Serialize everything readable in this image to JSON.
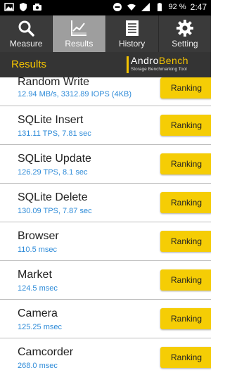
{
  "status": {
    "battery": "92 %",
    "time": "2:47"
  },
  "tabs": [
    {
      "label": "Measure",
      "icon": "search-icon"
    },
    {
      "label": "Results",
      "icon": "chart-icon"
    },
    {
      "label": "History",
      "icon": "list-icon"
    },
    {
      "label": "Setting",
      "icon": "gear-icon"
    }
  ],
  "header": {
    "title": "Results",
    "brand_name_a": "Andro",
    "brand_name_b": "Bench",
    "brand_tagline": "Storage Benchmarking Tool"
  },
  "results": [
    {
      "name": "Random Write",
      "value": "12.94 MB/s, 3312.89 IOPS (4KB)",
      "button": "Ranking"
    },
    {
      "name": "SQLite Insert",
      "value": "131.11 TPS, 7.81 sec",
      "button": "Ranking"
    },
    {
      "name": "SQLite Update",
      "value": "126.29 TPS, 8.1 sec",
      "button": "Ranking"
    },
    {
      "name": "SQLite Delete",
      "value": "130.09 TPS, 7.87 sec",
      "button": "Ranking"
    },
    {
      "name": "Browser",
      "value": "110.5 msec",
      "button": "Ranking"
    },
    {
      "name": "Market",
      "value": "124.5 msec",
      "button": "Ranking"
    },
    {
      "name": "Camera",
      "value": "125.25 msec",
      "button": "Ranking"
    },
    {
      "name": "Camcorder",
      "value": "268.0 msec",
      "button": "Ranking"
    }
  ]
}
